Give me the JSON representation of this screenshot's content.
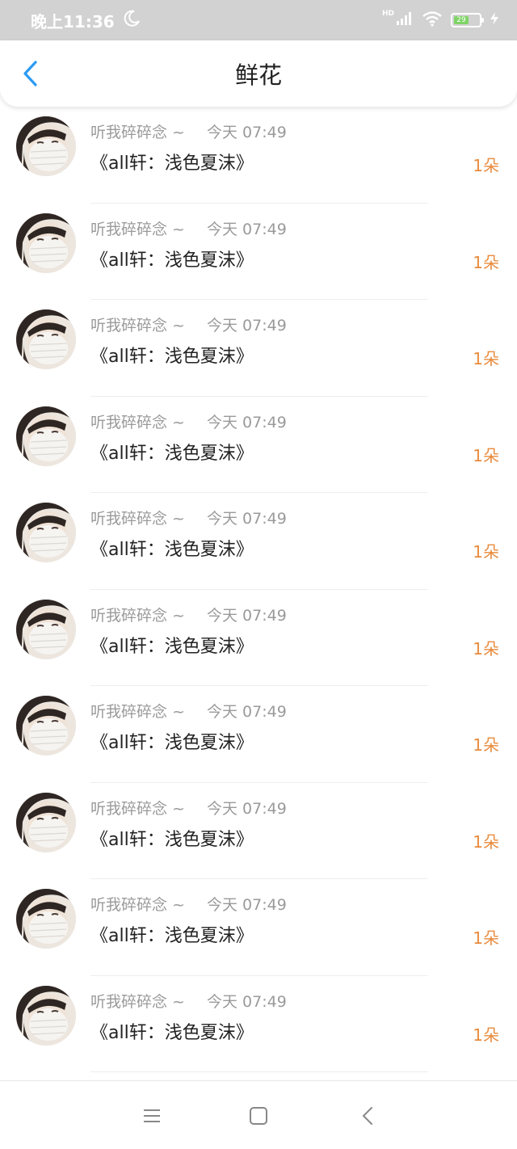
{
  "status": {
    "time": "晚上11:36",
    "hd": "HD",
    "battery": "29"
  },
  "header": {
    "title": "鲜花"
  },
  "items": [
    {
      "name": "听我碎碎念 ~",
      "time": "今天 07:49",
      "message": "《all轩：浅色夏沫》",
      "count": "1朵"
    },
    {
      "name": "听我碎碎念 ~",
      "time": "今天 07:49",
      "message": "《all轩：浅色夏沫》",
      "count": "1朵"
    },
    {
      "name": "听我碎碎念 ~",
      "time": "今天 07:49",
      "message": "《all轩：浅色夏沫》",
      "count": "1朵"
    },
    {
      "name": "听我碎碎念 ~",
      "time": "今天 07:49",
      "message": "《all轩：浅色夏沫》",
      "count": "1朵"
    },
    {
      "name": "听我碎碎念 ~",
      "time": "今天 07:49",
      "message": "《all轩：浅色夏沫》",
      "count": "1朵"
    },
    {
      "name": "听我碎碎念 ~",
      "time": "今天 07:49",
      "message": "《all轩：浅色夏沫》",
      "count": "1朵"
    },
    {
      "name": "听我碎碎念 ~",
      "time": "今天 07:49",
      "message": "《all轩：浅色夏沫》",
      "count": "1朵"
    },
    {
      "name": "听我碎碎念 ~",
      "time": "今天 07:49",
      "message": "《all轩：浅色夏沫》",
      "count": "1朵"
    },
    {
      "name": "听我碎碎念 ~",
      "time": "今天 07:49",
      "message": "《all轩：浅色夏沫》",
      "count": "1朵"
    },
    {
      "name": "听我碎碎念 ~",
      "time": "今天 07:49",
      "message": "《all轩：浅色夏沫》",
      "count": "1朵"
    }
  ],
  "icons": {
    "back": "chevron-left-icon",
    "moon": "moon-icon",
    "signal": "signal-icon",
    "wifi": "wifi-icon",
    "charging": "bolt-icon",
    "menu": "menu-icon",
    "home": "home-icon",
    "nav_back": "nav-back-icon"
  },
  "colors": {
    "accent": "#2b9af3",
    "count": "#e88b3d",
    "status_bar": "#d2d2d2"
  }
}
